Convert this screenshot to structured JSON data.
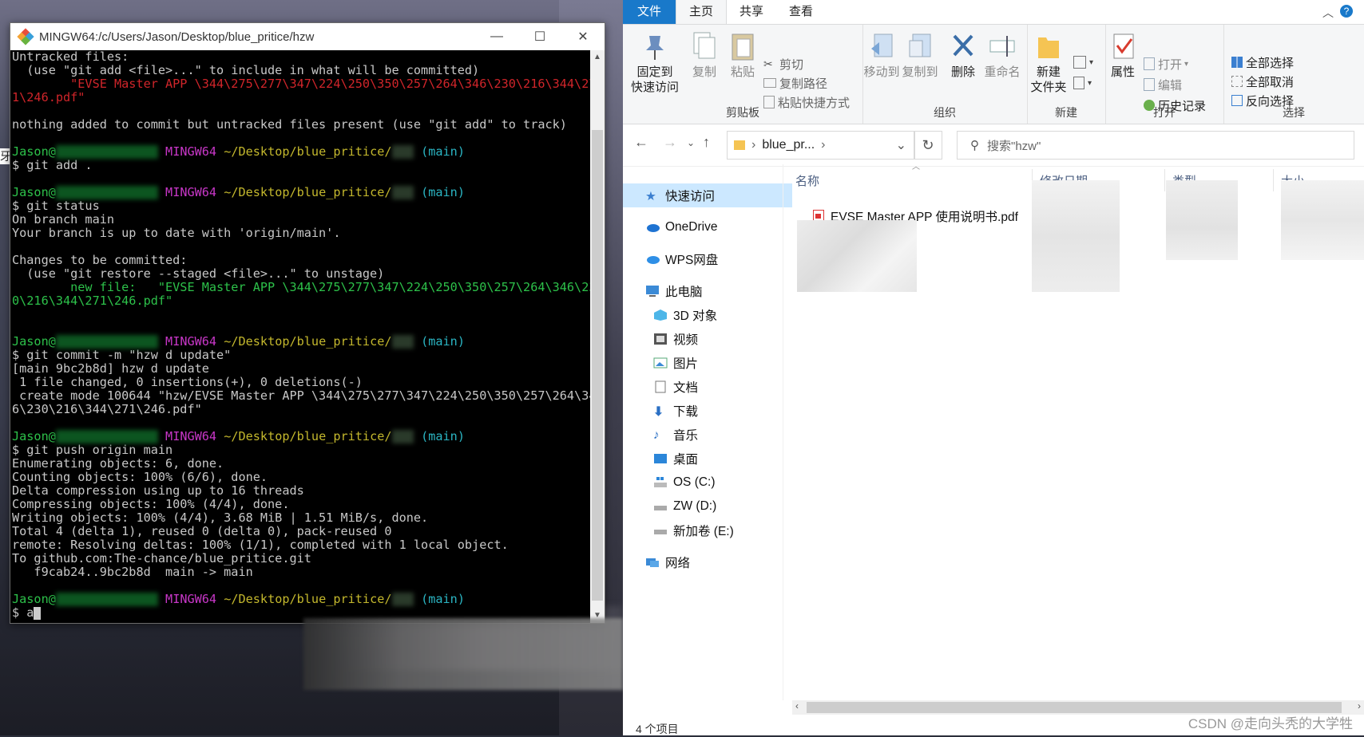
{
  "terminal": {
    "title": "MINGW64:/c/Users/Jason/Desktop/blue_pritice/hzw",
    "lines": {
      "l1": "Untracked files:",
      "l2": "  (use \"git add <file>...\" to include in what will be committed)",
      "l3": "        \"EVSE Master APP \\344\\275\\277\\347\\224\\250\\350\\257\\264\\346\\230\\216\\344\\27",
      "l4": "1\\246.pdf\"",
      "l5": "nothing added to commit but untracked files present (use \"git add\" to track)",
      "user": "Jason@",
      "host": "MINGW64",
      "path": " ~/Desktop/blue_pritice/",
      "branch": " (main)",
      "cmd1": "$ git add .",
      "cmd2": "$ git status",
      "s1": "On branch main",
      "s2": "Your branch is up to date with 'origin/main'.",
      "s3": "Changes to be committed:",
      "s4": "  (use \"git restore --staged <file>...\" to unstage)",
      "s5": "        new file:   \"EVSE Master APP \\344\\275\\277\\347\\224\\250\\350\\257\\264\\346\\23",
      "s6": "0\\216\\344\\271\\246.pdf\"",
      "cmd3": "$ git commit -m \"hzw d update\"",
      "c1": "[main 9bc2b8d] hzw d update",
      "c2": " 1 file changed, 0 insertions(+), 0 deletions(-)",
      "c3": " create mode 100644 \"hzw/EVSE Master APP \\344\\275\\277\\347\\224\\250\\350\\257\\264\\34",
      "c4": "6\\230\\216\\344\\271\\246.pdf\"",
      "cmd4": "$ git push origin main",
      "p1": "Enumerating objects: 6, done.",
      "p2": "Counting objects: 100% (6/6), done.",
      "p3": "Delta compression using up to 16 threads",
      "p4": "Compressing objects: 100% (4/4), done.",
      "p5": "Writing objects: 100% (4/4), 3.68 MiB | 1.51 MiB/s, done.",
      "p6": "Total 4 (delta 1), reused 0 (delta 0), pack-reused 0",
      "p7": "remote: Resolving deltas: 100% (1/1), completed with 1 local object.",
      "p8": "To github.com:The-chance/blue_pritice.git",
      "p9": "   f9cab24..9bc2b8d  main -> main",
      "host_last": "MINGW64",
      "prompt": "$ a"
    },
    "side_char": "牙"
  },
  "explorer": {
    "tabs": [
      "文件",
      "主页",
      "共享",
      "查看"
    ],
    "ribbon": {
      "pin_quick": "固定到\n快速访问",
      "copy": "复制",
      "paste": "粘贴",
      "cut": "剪切",
      "copy_path": "复制路径",
      "paste_shortcut": "粘贴快捷方式",
      "clipboard": "剪贴板",
      "move_to": "移动到",
      "copy_to": "复制到",
      "delete": "删除",
      "rename": "重命名",
      "organize": "组织",
      "new_folder": "新建\n文件夹",
      "new": "新建",
      "properties": "属性",
      "open": "打开",
      "edit": "编辑",
      "history": "历史记录",
      "open_group": "打开",
      "select_all": "全部选择",
      "select_none": "全部取消",
      "invert": "反向选择",
      "select": "选择"
    },
    "address": "blue_pr...",
    "address_sep": "›",
    "search_placeholder": "搜索\"hzw\"",
    "nav": {
      "quick": "快速访问",
      "onedrive": "OneDrive",
      "wps": "WPS网盘",
      "pc": "此电脑",
      "obj3d": "3D 对象",
      "video": "视频",
      "pictures": "图片",
      "docs": "文档",
      "downloads": "下载",
      "music": "音乐",
      "desktop": "桌面",
      "c": "OS (C:)",
      "d": "ZW (D:)",
      "e": "新加卷 (E:)",
      "network": "网络"
    },
    "columns": {
      "name": "名称",
      "date": "修改日期",
      "type": "类型",
      "size": "大小"
    },
    "file_name": "EVSE Master APP 使用说明书.pdf",
    "status": "4 个项目",
    "watermark": "CSDN @走向头秃的大学牲"
  }
}
